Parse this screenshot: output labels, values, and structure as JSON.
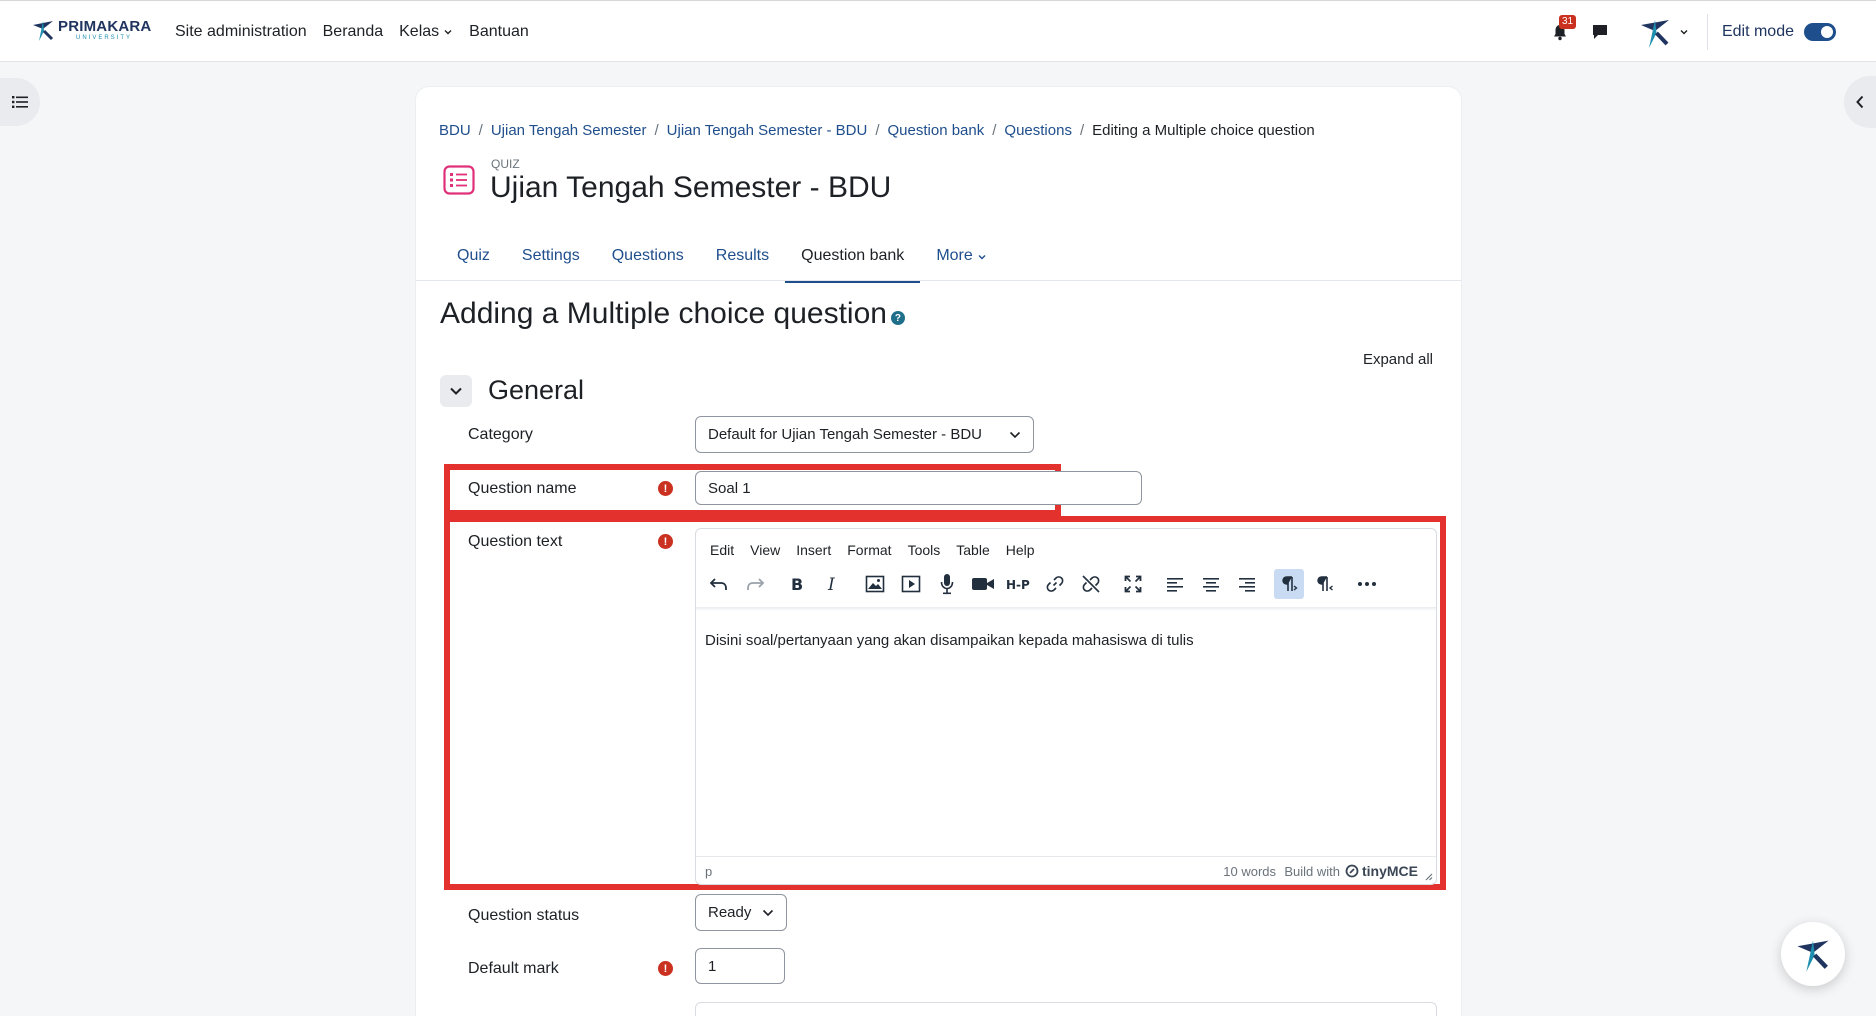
{
  "brand": {
    "name": "PRIMAKARA",
    "sub": "UNIVERSITY"
  },
  "nav": {
    "items": [
      "Site administration",
      "Beranda",
      "Kelas",
      "Bantuan"
    ],
    "notif_count": "31",
    "edit_mode_label": "Edit mode"
  },
  "breadcrumb": [
    "BDU",
    "Ujian Tengah Semester",
    "Ujian Tengah Semester - BDU",
    "Question bank",
    "Questions",
    "Editing a Multiple choice question"
  ],
  "page": {
    "module_label": "QUIZ",
    "title": "Ujian Tengah Semester - BDU",
    "tabs": [
      "Quiz",
      "Settings",
      "Questions",
      "Results",
      "Question bank",
      "More"
    ],
    "active_tab": "Question bank",
    "heading": "Adding a Multiple choice question",
    "help_glyph": "?",
    "expand_all": "Expand all",
    "section_title": "General"
  },
  "form": {
    "category_label": "Category",
    "category_value": "Default for Ujian Tengah Semester - BDU",
    "question_name_label": "Question name",
    "question_name_value": "Soal 1",
    "question_text_label": "Question text",
    "question_status_label": "Question status",
    "question_status_value": "Ready",
    "default_mark_label": "Default mark",
    "default_mark_value": "1",
    "required_glyph": "!"
  },
  "editor": {
    "menus": [
      "Edit",
      "View",
      "Insert",
      "Format",
      "Tools",
      "Table",
      "Help"
    ],
    "content": "Disini soal/pertanyaan yang akan disampaikan kepada mahasiswa di tulis",
    "path": "p",
    "word_count": "10 words",
    "build_with": "Build with",
    "brand": "tinyMCE"
  },
  "colors": {
    "accent": "#1f4e8c",
    "highlight": "#e3312d",
    "required": "#ca3120"
  }
}
